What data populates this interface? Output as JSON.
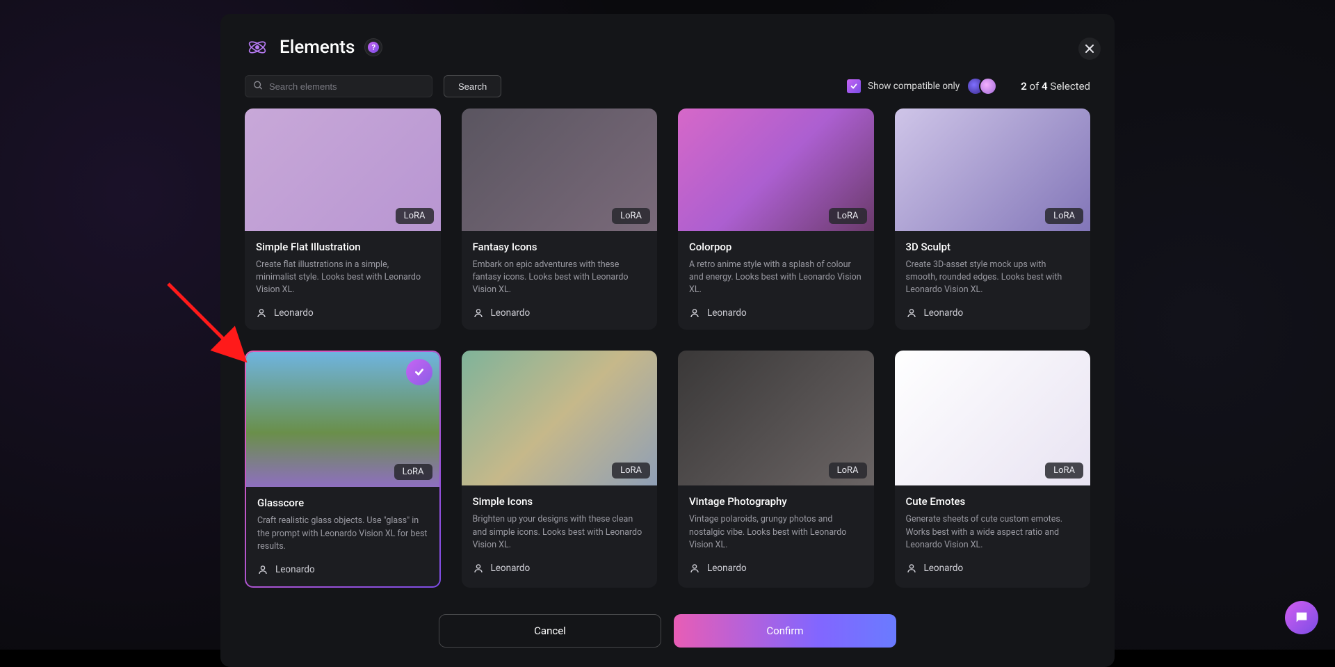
{
  "header": {
    "title": "Elements",
    "help_glyph": "?"
  },
  "search": {
    "placeholder": "Search elements",
    "button": "Search"
  },
  "compat_label": "Show compatible only",
  "selection_status": {
    "count": "2",
    "of": "of",
    "max": "4",
    "suffix": "Selected"
  },
  "badge": "LoRA",
  "cards": [
    {
      "title": "Simple Flat Illustration",
      "desc": "Create flat illustrations in a simple, minimalist style. Looks best with Leonardo Vision XL.",
      "author": "Leonardo"
    },
    {
      "title": "Fantasy Icons",
      "desc": "Embark on epic adventures with these fantasy icons. Looks best with Leonardo Vision XL.",
      "author": "Leonardo"
    },
    {
      "title": "Colorpop",
      "desc": "A retro anime style with a splash of colour and energy. Looks best with Leonardo Vision XL.",
      "author": "Leonardo"
    },
    {
      "title": "3D Sculpt",
      "desc": "Create 3D-asset style mock ups with smooth, rounded edges. Looks best with Leonardo Vision XL.",
      "author": "Leonardo"
    },
    {
      "title": "Glasscore",
      "desc": "Craft realistic glass objects. Use \"glass\" in the prompt with Leonardo Vision XL for best results.",
      "author": "Leonardo"
    },
    {
      "title": "Simple Icons",
      "desc": "Brighten up your designs with these clean and simple icons. Looks best with Leonardo Vision XL.",
      "author": "Leonardo"
    },
    {
      "title": "Vintage Photography",
      "desc": "Vintage polaroids, grungy photos and nostalgic vibe. Looks best with Leonardo Vision XL.",
      "author": "Leonardo"
    },
    {
      "title": "Cute Emotes",
      "desc": "Generate sheets of cute custom emotes. Works best with a wide aspect ratio and Leonardo Vision XL.",
      "author": "Leonardo"
    }
  ],
  "footer": {
    "cancel": "Cancel",
    "confirm": "Confirm"
  }
}
